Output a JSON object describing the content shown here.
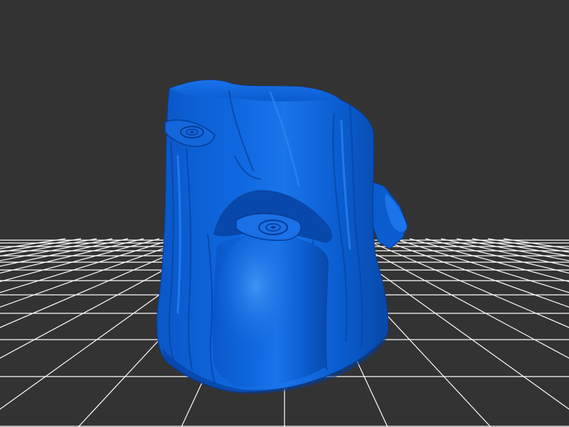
{
  "viewport": {
    "background_color": "#333333",
    "grid_color": "#ffffff"
  },
  "model": {
    "name": "tree-stump",
    "color": "#0a5fd6",
    "highlight_color": "#3a8cf0",
    "shadow_color": "#063c96"
  }
}
